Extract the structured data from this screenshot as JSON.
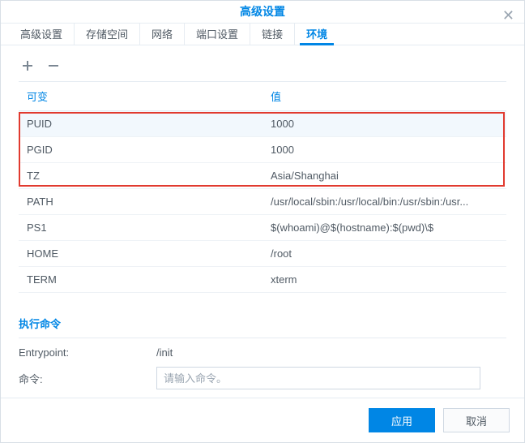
{
  "dialog": {
    "title": "高级设置"
  },
  "tabs": [
    {
      "label": "高级设置",
      "active": false
    },
    {
      "label": "存储空间",
      "active": false
    },
    {
      "label": "网络",
      "active": false
    },
    {
      "label": "端口设置",
      "active": false
    },
    {
      "label": "链接",
      "active": false
    },
    {
      "label": "环境",
      "active": true
    }
  ],
  "table": {
    "headers": {
      "variable": "可变",
      "value": "值"
    },
    "rows": [
      {
        "variable": "PUID",
        "value": "1000",
        "selected": true
      },
      {
        "variable": "PGID",
        "value": "1000",
        "selected": false
      },
      {
        "variable": "TZ",
        "value": "Asia/Shanghai",
        "selected": false
      },
      {
        "variable": "PATH",
        "value": "/usr/local/sbin:/usr/local/bin:/usr/sbin:/usr...",
        "selected": false
      },
      {
        "variable": "PS1",
        "value": "$(whoami)@$(hostname):$(pwd)\\$",
        "selected": false
      },
      {
        "variable": "HOME",
        "value": "/root",
        "selected": false
      },
      {
        "variable": "TERM",
        "value": "xterm",
        "selected": false
      }
    ]
  },
  "exec": {
    "title": "执行命令",
    "entrypoint_label": "Entrypoint:",
    "entrypoint_value": "/init",
    "command_label": "命令:",
    "command_placeholder": "请输入命令。"
  },
  "footer": {
    "apply": "应用",
    "cancel": "取消"
  }
}
